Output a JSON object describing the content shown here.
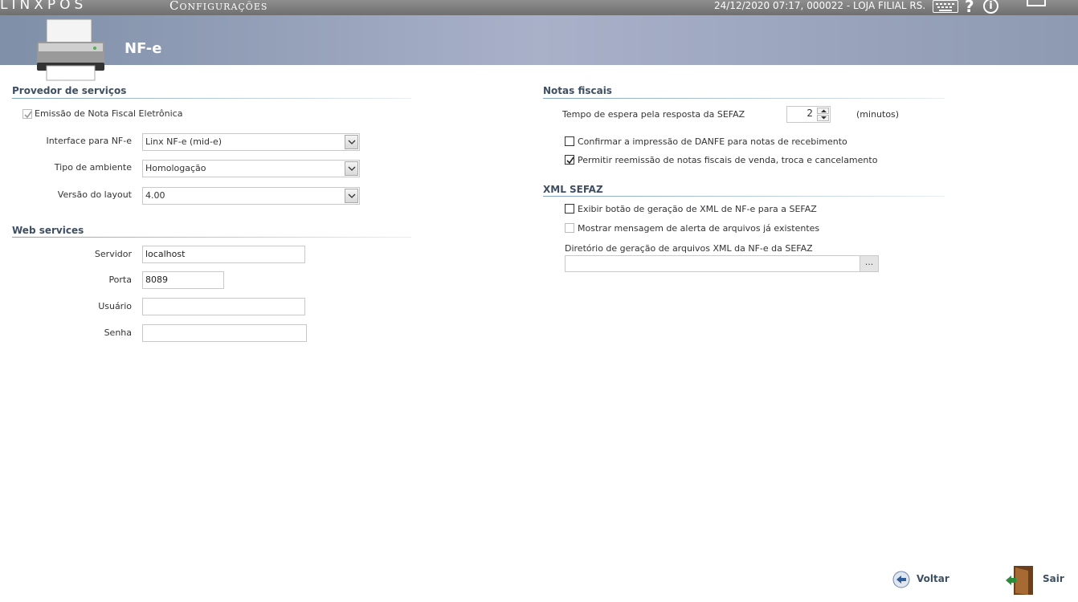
{
  "topbar": {
    "brand": "LINXPOS",
    "app_title": "Configurações",
    "datetime_store": "24/12/2020 07:17, 000022 - LOJA FILIAL RS.",
    "icons": [
      "keyboard-icon",
      "help-icon",
      "info-icon",
      "minimize-icon"
    ]
  },
  "header": {
    "title": "NF-e",
    "icon": "printer-icon"
  },
  "provedor": {
    "title": "Provedor de serviços",
    "emissao_label": "Emissão de Nota Fiscal Eletrônica",
    "emissao_checked": true,
    "interface_label": "Interface para NF-e",
    "interface_value": "Linx NF-e (mid-e)",
    "ambiente_label": "Tipo de ambiente",
    "ambiente_value": "Homologação",
    "versao_label": "Versão do layout",
    "versao_value": "4.00"
  },
  "webservices": {
    "title": "Web services",
    "servidor_label": "Servidor",
    "servidor_value": "localhost",
    "porta_label": "Porta",
    "porta_value": "8089",
    "usuario_label": "Usuário",
    "usuario_value": "",
    "senha_label": "Senha",
    "senha_value": ""
  },
  "notas": {
    "title": "Notas fiscais",
    "tempo_label": "Tempo de espera pela resposta da SEFAZ",
    "tempo_value": "2",
    "tempo_unit": "(minutos)",
    "confirmar_label": "Confirmar a impressão de DANFE para notas de recebimento",
    "confirmar_checked": false,
    "permitir_label": "Permitir reemissão de notas fiscais de venda, troca e cancelamento",
    "permitir_checked": true
  },
  "xml": {
    "title": "XML SEFAZ",
    "exibir_label": "Exibir botão de geração de XML de NF-e para a SEFAZ",
    "exibir_checked": false,
    "mostrar_label": "Mostrar mensagem de alerta de arquivos já existentes",
    "mostrar_checked": false,
    "diretorio_label": "Diretório de geração de arquivos XML da NF-e da SEFAZ",
    "diretorio_value": "",
    "browse_label": "..."
  },
  "footer": {
    "voltar": "Voltar",
    "sair": "Sair"
  }
}
